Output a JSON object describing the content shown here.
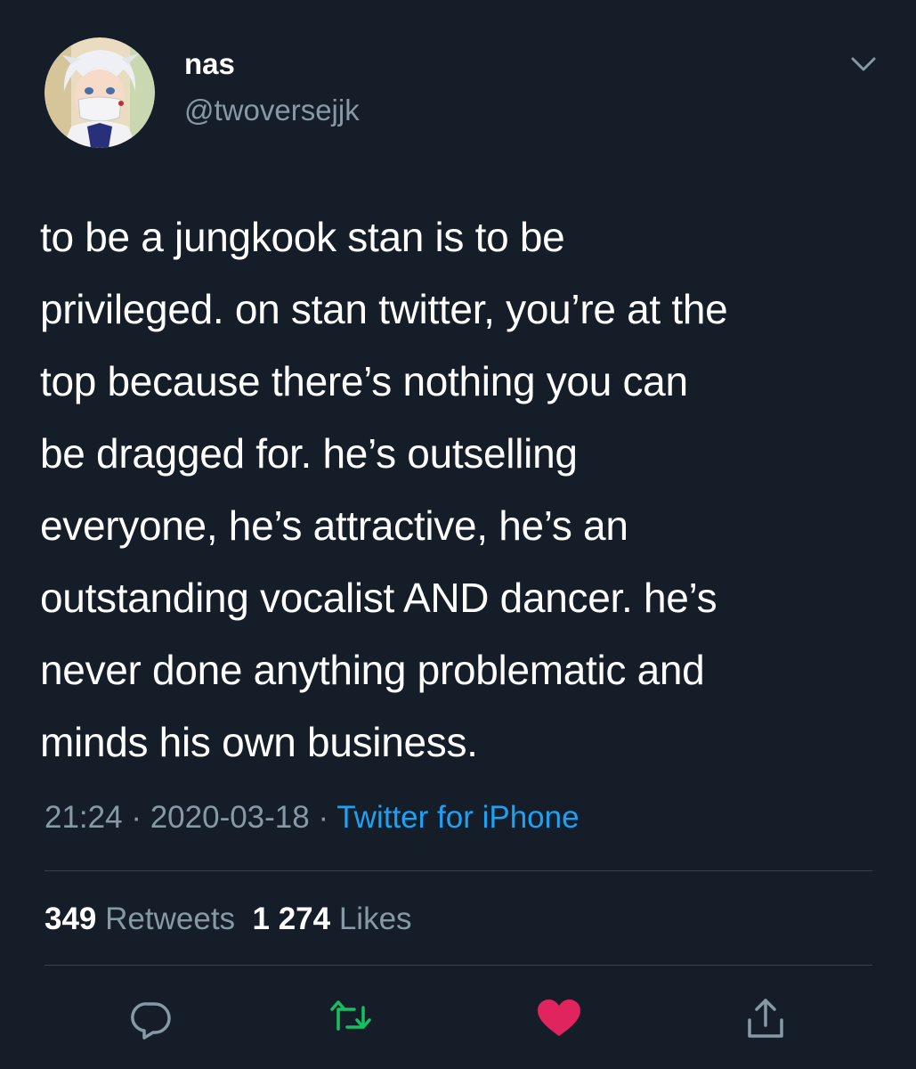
{
  "user": {
    "name": "nas",
    "handle": "@twoversejjk"
  },
  "tweet": {
    "lines": [
      "to be a jungkook stan is to be",
      "privileged. on stan twitter, you’re at the",
      "top because there’s nothing you can",
      "be dragged for. he’s outselling",
      "everyone, he’s attractive, he’s an",
      "outstanding vocalist AND dancer. he’s",
      "never done anything problematic and",
      "minds his own business."
    ]
  },
  "meta": {
    "time": "21:24",
    "separator1": " · ",
    "date": "2020-03-18",
    "separator2": " · ",
    "source": "Twitter for iPhone"
  },
  "stats": {
    "retweets_count": "349",
    "retweets_label": "Retweets",
    "likes_count": "1 274",
    "likes_label": "Likes"
  },
  "actions": {
    "icons": [
      "reply-icon",
      "retweet-icon",
      "like-icon",
      "share-icon"
    ]
  },
  "colors": {
    "background": "#151e28",
    "secondary_text": "#8899a6",
    "link": "#1da1f2",
    "retweet": "#17bf63",
    "like": "#e0245e"
  }
}
